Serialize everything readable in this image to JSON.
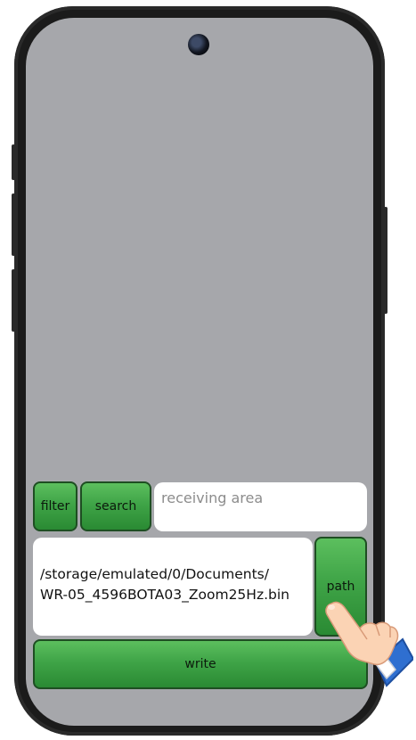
{
  "controls": {
    "filter_label": "filter",
    "search_label": "search",
    "receive_placeholder": "receiving area",
    "file_path": "/storage/emulated/0/Documents/\nWR-05_4596BOTA03_Zoom25Hz.bin",
    "path_label": "path",
    "write_label": "write"
  },
  "colors": {
    "screen_bg": "#a6a7ab",
    "button_green": "#3fa447",
    "phone_frame": "#1b1b1b"
  },
  "icons": {
    "camera": "front-camera-icon",
    "hand": "pointing-hand-icon"
  }
}
